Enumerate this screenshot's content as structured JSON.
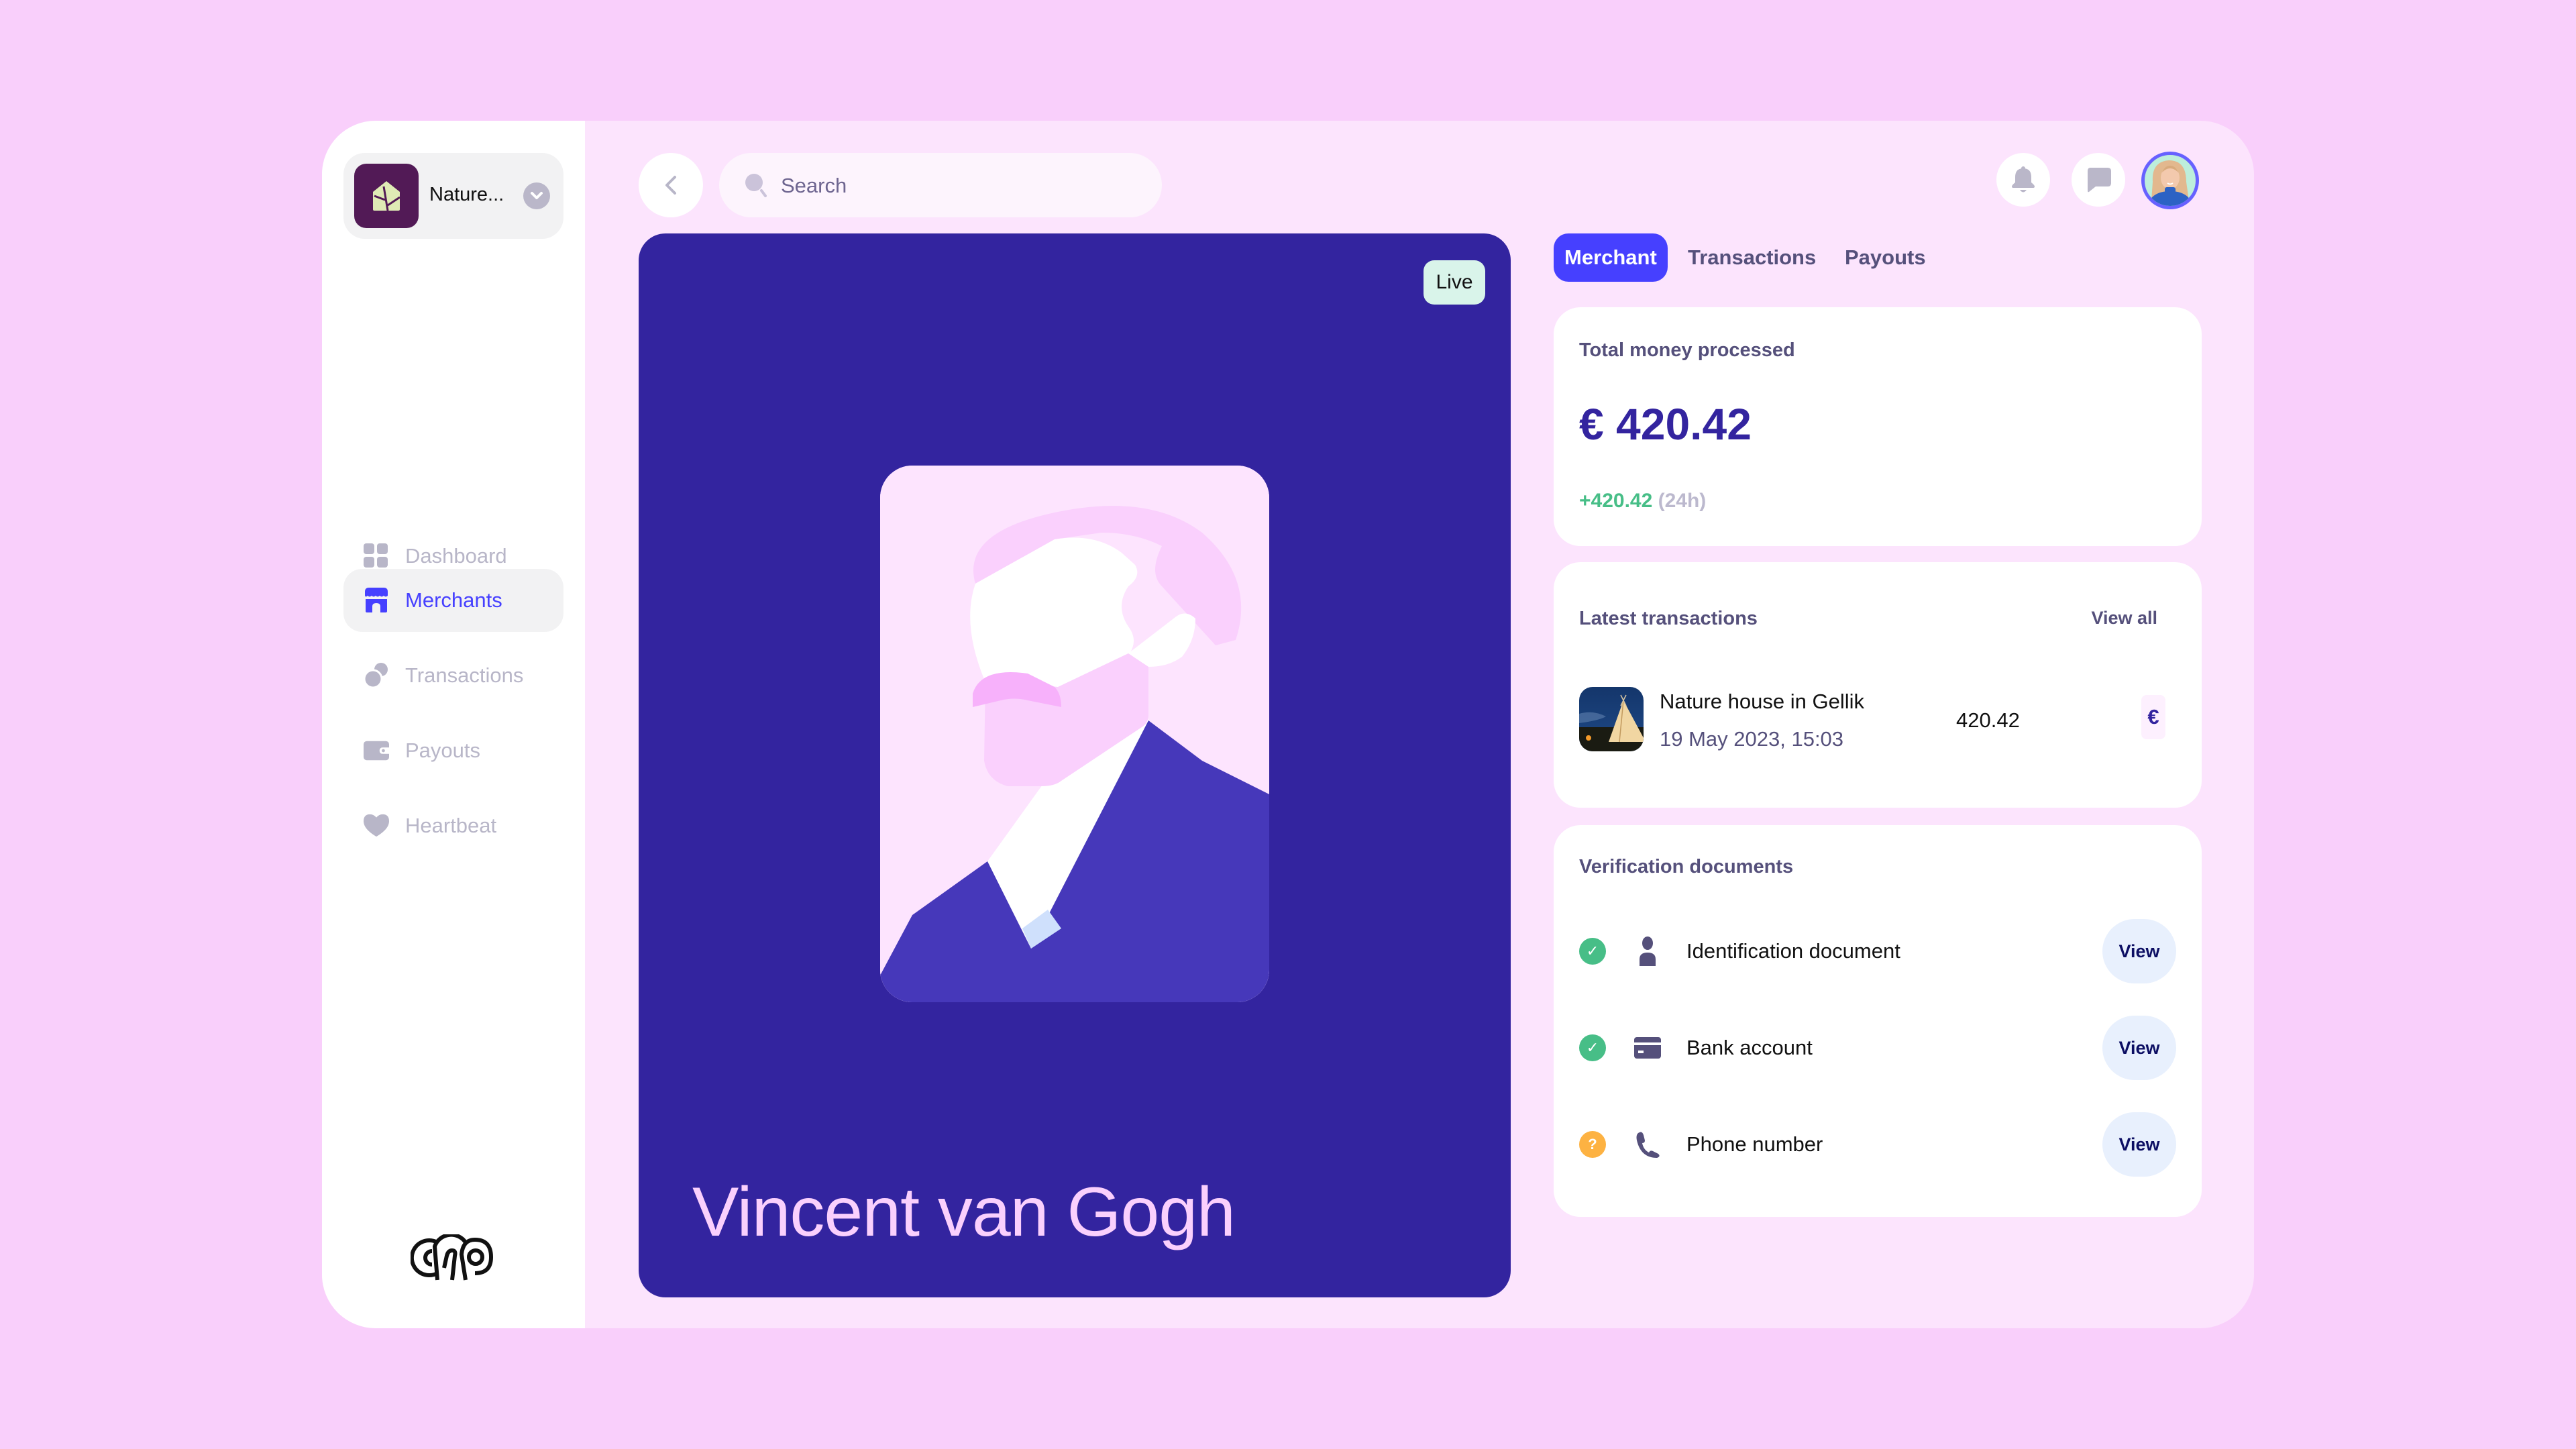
{
  "sidebar": {
    "merchant_switcher": {
      "name": "Nature...",
      "icon": "leaf-house-icon"
    },
    "items": [
      {
        "label": "Dashboard",
        "icon": "grid-icon",
        "active": false
      },
      {
        "label": "Merchants",
        "icon": "storefront-icon",
        "active": true
      },
      {
        "label": "Transactions",
        "icon": "coins-icon",
        "active": false
      },
      {
        "label": "Payouts",
        "icon": "wallet-icon",
        "active": false
      },
      {
        "label": "Heartbeat",
        "icon": "heart-icon",
        "active": false
      }
    ],
    "brand_logo": "cfp-logo"
  },
  "header": {
    "back_icon": "chevron-left-icon",
    "search": {
      "placeholder": "Search",
      "value": ""
    },
    "actions": [
      {
        "name": "notifications",
        "icon": "bell-icon"
      },
      {
        "name": "messages",
        "icon": "chat-bubble-icon"
      }
    ],
    "avatar_alt": "User avatar"
  },
  "portrait": {
    "status_badge": "Live",
    "name": "Vincent van Gogh",
    "colors": {
      "card_bg": "#33249f",
      "frame_bg": "#fde4fe",
      "name_color": "#fad0fd"
    }
  },
  "tabs": [
    {
      "label": "Merchant",
      "active": true
    },
    {
      "label": "Transactions",
      "active": false
    },
    {
      "label": "Payouts",
      "active": false
    }
  ],
  "total_money": {
    "title": "Total money processed",
    "value": "€ 420.42",
    "delta": "+420.42",
    "period": "(24h)"
  },
  "latest_transactions": {
    "title": "Latest transactions",
    "view_all": "View all",
    "items": [
      {
        "name": "Nature house in Gellik",
        "date": "19 May 2023, 15:03",
        "amount": "420.42",
        "currency": "€"
      }
    ]
  },
  "verification": {
    "title": "Verification documents",
    "items": [
      {
        "label": "Identification document",
        "status": "verified",
        "status_glyph": "✓",
        "icon": "person-icon",
        "action": "View"
      },
      {
        "label": "Bank account",
        "status": "verified",
        "status_glyph": "✓",
        "icon": "card-icon",
        "action": "View"
      },
      {
        "label": "Phone number",
        "status": "pending",
        "status_glyph": "?",
        "icon": "phone-icon",
        "action": "View"
      }
    ]
  },
  "colors": {
    "accent": "#4640ff",
    "page_bg": "#f9cffb",
    "panel_bg": "#fce4fd",
    "success": "#47be87",
    "warning": "#fdb242",
    "muted_text": "#55507b"
  }
}
